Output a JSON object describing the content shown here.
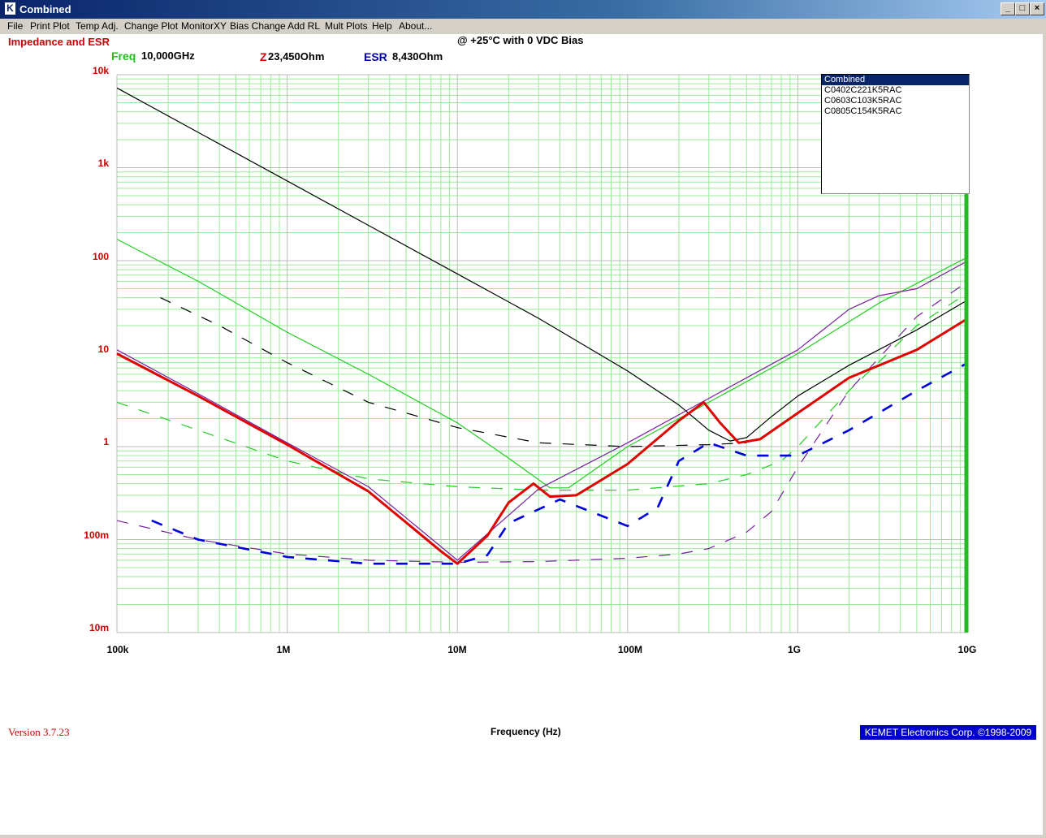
{
  "window": {
    "title": "Combined",
    "controls": [
      "_",
      "□",
      "×"
    ]
  },
  "menu": [
    "File",
    "Print Plot",
    "Temp Adj.",
    "Change Plot",
    "MonitorXY",
    "Bias Change",
    "Add RL",
    "Mult Plots",
    "Help",
    "About..."
  ],
  "panel_title": "Impedance and ESR",
  "subtitle": "@ +25°C with 0 VDC Bias",
  "readouts": {
    "freq_key": "Freq",
    "freq_value": "10,000GHz",
    "z_key": "Z",
    "z_value": "23,450Ohm",
    "esr_key": "ESR",
    "esr_value": "8,430Ohm"
  },
  "legend": {
    "items": [
      "Combined",
      "C0402C221K5RAC",
      "C0603C103K5RAC",
      "C0805C154K5RAC"
    ],
    "selected": 0
  },
  "footer": {
    "version": "Version 3.7.23",
    "copyright": "KEMET Electronics Corp. ©1998-2009"
  },
  "colors": {
    "combined": "#e00000",
    "combined_esr": "#0000dd",
    "c0402": "#000000",
    "c0603": "#22cc22",
    "c0805": "#7a1fa0",
    "grid": "#99ee99",
    "major_grid": "#bbbbbb",
    "cursor": "#22bb22"
  },
  "chart_data": {
    "type": "line",
    "xlabel": "Frequency (Hz)",
    "ylabel": "",
    "x_scale": "log",
    "y_scale": "log",
    "xlim": [
      100000,
      10000000000
    ],
    "ylim": [
      0.01,
      10000
    ],
    "x_ticks": [
      "100k",
      "1M",
      "10M",
      "100M",
      "1G",
      "10G"
    ],
    "y_ticks": [
      "10k",
      "1k",
      "100",
      "10",
      "1",
      "100m",
      "10m"
    ],
    "cursor_x": 10000000000,
    "series": [
      {
        "name": "C0402C221K5RAC",
        "kind": "impedance",
        "x": [
          100000,
          300000,
          1000000,
          3000000,
          10000000,
          30000000,
          100000000,
          200000000,
          300000000,
          400000000,
          500000000,
          700000000,
          1000000000,
          2000000000,
          5000000000,
          10000000000
        ],
        "y": [
          7200,
          2400,
          720,
          240,
          72,
          24,
          6.5,
          2.8,
          1.5,
          1.15,
          1.25,
          2.1,
          3.5,
          7.5,
          18,
          38
        ]
      },
      {
        "name": "C0402C221K5RAC",
        "kind": "esr",
        "x": [
          180000,
          400000,
          1000000,
          3000000,
          10000000,
          30000000,
          100000000,
          300000000,
          500000000
        ],
        "y": [
          40,
          20,
          8,
          3,
          1.6,
          1.1,
          1.0,
          1.05,
          1.1
        ]
      },
      {
        "name": "C0603C103K5RAC",
        "kind": "impedance",
        "x": [
          100000,
          300000,
          1000000,
          3000000,
          10000000,
          20000000,
          35000000,
          45000000,
          100000000,
          300000000,
          1000000000,
          3000000000,
          10000000000
        ],
        "y": [
          170,
          60,
          17,
          6,
          1.8,
          0.75,
          0.36,
          0.36,
          1.0,
          3.0,
          10,
          35,
          110
        ]
      },
      {
        "name": "C0603C103K5RAC",
        "kind": "esr",
        "x": [
          100000,
          300000,
          1000000,
          3000000,
          10000000,
          30000000,
          100000000,
          300000000,
          500000000,
          800000000,
          1000000000,
          2000000000,
          5000000000,
          10000000000
        ],
        "y": [
          3,
          1.5,
          0.7,
          0.45,
          0.37,
          0.34,
          0.34,
          0.4,
          0.5,
          0.7,
          1.0,
          4,
          20,
          45
        ]
      },
      {
        "name": "C0805C154K5RAC",
        "kind": "impedance",
        "x": [
          100000,
          300000,
          1000000,
          3000000,
          10000000,
          30000000,
          100000000,
          300000000,
          1000000000,
          2000000000,
          3000000000,
          5000000000,
          10000000000
        ],
        "y": [
          11,
          3.7,
          1.1,
          0.37,
          0.06,
          0.35,
          1.1,
          3.3,
          11,
          30,
          42,
          50,
          100
        ]
      },
      {
        "name": "C0805C154K5RAC",
        "kind": "esr",
        "x": [
          100000,
          300000,
          1000000,
          3000000,
          10000000,
          30000000,
          100000000,
          200000000,
          300000000,
          500000000,
          700000000,
          1000000000,
          2000000000,
          5000000000,
          10000000000
        ],
        "y": [
          0.16,
          0.1,
          0.07,
          0.06,
          0.057,
          0.058,
          0.063,
          0.07,
          0.08,
          0.12,
          0.2,
          0.6,
          4,
          25,
          60
        ]
      },
      {
        "name": "Combined",
        "kind": "impedance",
        "x": [
          100000,
          300000,
          1000000,
          3000000,
          8000000,
          10000000,
          15000000,
          20000000,
          28000000,
          35000000,
          50000000,
          100000000,
          200000000,
          280000000,
          350000000,
          450000000,
          600000000,
          1000000000,
          2000000000,
          5000000000,
          10000000000
        ],
        "y": [
          10,
          3.5,
          1.05,
          0.33,
          0.075,
          0.055,
          0.11,
          0.25,
          0.4,
          0.29,
          0.3,
          0.65,
          1.9,
          3.0,
          1.8,
          1.1,
          1.2,
          2.3,
          5.5,
          11,
          24
        ]
      },
      {
        "name": "Combined",
        "kind": "esr",
        "x": [
          160000,
          300000,
          1000000,
          3000000,
          10000000,
          15000000,
          20000000,
          40000000,
          100000000,
          150000000,
          200000000,
          300000000,
          500000000,
          1000000000,
          2000000000,
          5000000000,
          10000000000
        ],
        "y": [
          0.16,
          0.1,
          0.065,
          0.055,
          0.055,
          0.068,
          0.15,
          0.27,
          0.14,
          0.22,
          0.7,
          1.1,
          0.8,
          0.8,
          1.5,
          4.0,
          8.0
        ]
      }
    ]
  }
}
